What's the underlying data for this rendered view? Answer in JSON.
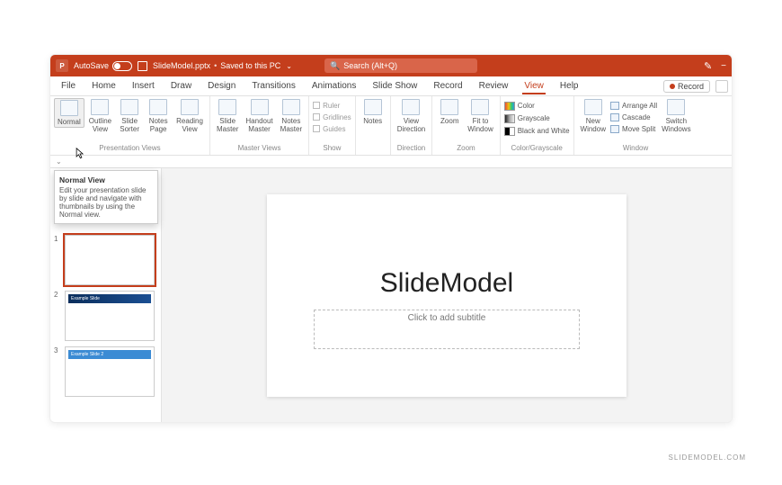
{
  "titlebar": {
    "autosave": "AutoSave",
    "filename": "SlideModel.pptx",
    "saved": "Saved to this PC",
    "search_placeholder": "Search (Alt+Q)",
    "minimize": "−"
  },
  "tabs": {
    "items": [
      "File",
      "Home",
      "Insert",
      "Draw",
      "Design",
      "Transitions",
      "Animations",
      "Slide Show",
      "Record",
      "Review",
      "View",
      "Help"
    ],
    "active_index": 10,
    "record": "Record"
  },
  "ribbon": {
    "presentation_views": {
      "label": "Presentation Views",
      "normal": "Normal",
      "outline": "Outline\nView",
      "sorter": "Slide\nSorter",
      "notes": "Notes\nPage",
      "reading": "Reading\nView"
    },
    "master_views": {
      "label": "Master Views",
      "slide": "Slide\nMaster",
      "handout": "Handout\nMaster",
      "notes": "Notes\nMaster"
    },
    "show": {
      "label": "Show",
      "ruler": "Ruler",
      "gridlines": "Gridlines",
      "guides": "Guides"
    },
    "notes_btn": "Notes",
    "direction": {
      "label": "Direction",
      "view_dir": "View\nDirection"
    },
    "zoom": {
      "label": "Zoom",
      "zoom": "Zoom",
      "fit": "Fit to\nWindow"
    },
    "color_grayscale": {
      "label": "Color/Grayscale",
      "color": "Color",
      "grayscale": "Grayscale",
      "bw": "Black and White"
    },
    "window": {
      "label": "Window",
      "new": "New\nWindow",
      "arrange": "Arrange All",
      "cascade": "Cascade",
      "move_split": "Move Split",
      "switch": "Switch\nWindows"
    }
  },
  "tooltip": {
    "title": "Normal View",
    "body": "Edit your presentation slide by slide and navigate with thumbnails by using the Normal view."
  },
  "thumbs": {
    "n1": "1",
    "n2": "2",
    "n3": "3",
    "t2": "Example Slide",
    "t3": "Example Slide 2"
  },
  "slide": {
    "title": "SlideModel",
    "subtitle_placeholder": "Click to add subtitle"
  },
  "watermark": "SLIDEMODEL.COM"
}
